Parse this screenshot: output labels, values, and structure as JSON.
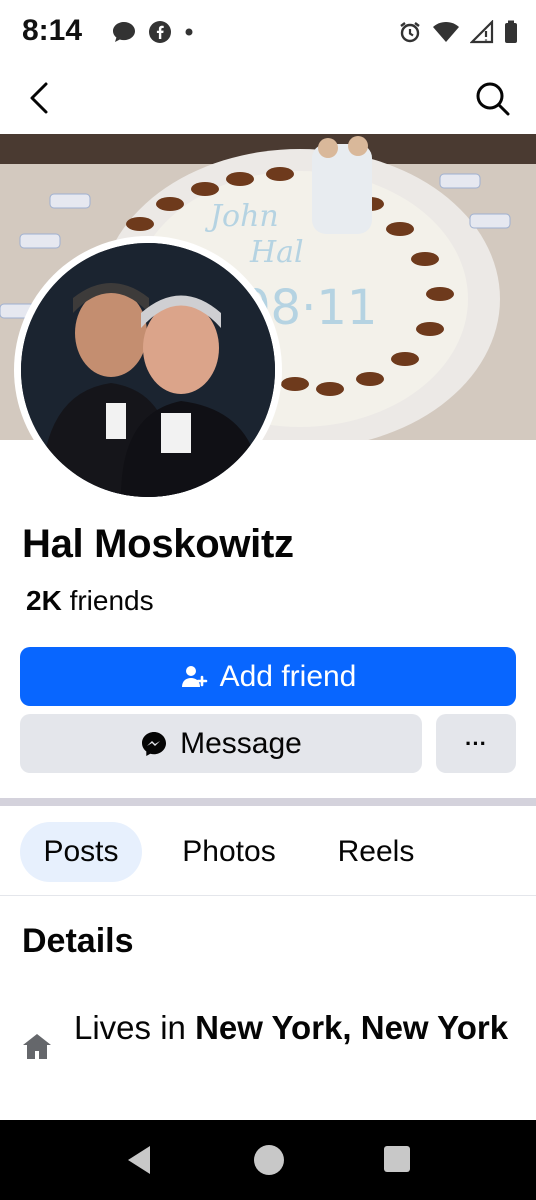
{
  "status_bar": {
    "time": "8:14",
    "left_icons": [
      "chat-bubble-icon",
      "facebook-icon",
      "dot-icon"
    ],
    "right_icons": [
      "alarm-icon",
      "wifi-icon",
      "signal-icon",
      "battery-icon"
    ]
  },
  "topbar": {
    "back_icon": "chevron-left-icon",
    "search_icon": "search-icon"
  },
  "cover": {
    "cake_text": [
      "John",
      "Hal",
      "08·11"
    ]
  },
  "profile": {
    "name": "Hal Moskowitz",
    "friends_count": "2K",
    "friends_label": "friends"
  },
  "actions": {
    "add_friend_label": "Add friend",
    "message_label": "Message",
    "more_label": "···"
  },
  "tabs": [
    {
      "label": "Posts",
      "active": true
    },
    {
      "label": "Photos",
      "active": false
    },
    {
      "label": "Reels",
      "active": false
    }
  ],
  "details": {
    "title": "Details",
    "lives_prefix": "Lives in",
    "lives_location": "New York, New York"
  },
  "colors": {
    "accent": "#0866ff",
    "button_gray": "#e4e6eb",
    "active_tab_bg": "#e7f0fd"
  }
}
